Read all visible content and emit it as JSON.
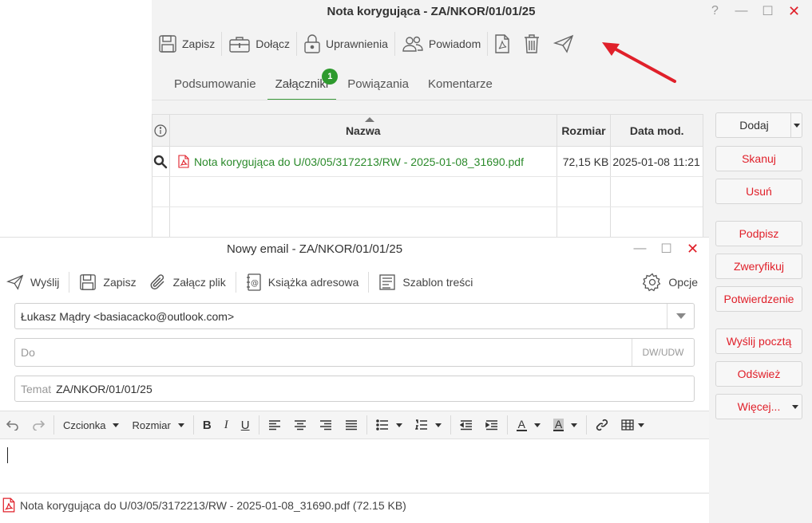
{
  "main_window": {
    "title": "Nota korygująca - ZA/NKOR/01/01/25",
    "controls": {
      "help": "?",
      "minimize": "—",
      "maximize": "☐",
      "close": "✕"
    },
    "toolbar": {
      "save": "Zapisz",
      "attach": "Dołącz",
      "permissions": "Uprawnienia",
      "notify": "Powiadom"
    },
    "tabs": [
      {
        "label": "Podsumowanie"
      },
      {
        "label": "Załączniki",
        "badge": "1"
      },
      {
        "label": "Powiązania"
      },
      {
        "label": "Komentarze"
      }
    ],
    "grid": {
      "columns": {
        "name": "Nazwa",
        "size": "Rozmiar",
        "date": "Data mod."
      },
      "rows": [
        {
          "name": "Nota korygująca do U/03/05/3172213/RW - 2025-01-08_31690.pdf",
          "size": "72,15 KB",
          "date": "2025-01-08 11:21"
        }
      ]
    },
    "actions": {
      "add": "Dodaj",
      "scan": "Skanuj",
      "delete": "Usuń",
      "sign": "Podpisz",
      "verify": "Zweryfikuj",
      "confirmation": "Potwierdzenie",
      "send_mail": "Wyślij pocztą",
      "refresh": "Odśwież",
      "more": "Więcej..."
    }
  },
  "email_window": {
    "title": "Nowy email - ZA/NKOR/01/01/25",
    "controls": {
      "minimize": "—",
      "maximize": "☐",
      "close": "✕"
    },
    "toolbar": {
      "send": "Wyślij",
      "save": "Zapisz",
      "attach": "Załącz plik",
      "address_book": "Książka adresowa",
      "template": "Szablon treści",
      "options": "Opcje"
    },
    "from": "Łukasz Mądry <basiacacko@outlook.com>",
    "to": {
      "placeholder": "Do",
      "value": "",
      "dw_label": "DW/UDW"
    },
    "subject": {
      "label": "Temat",
      "value": "ZA/NKOR/01/01/25"
    },
    "editor": {
      "font": "Czcionka",
      "size": "Rozmiar",
      "bold": "B",
      "italic": "I",
      "underline": "U",
      "text_color": "A",
      "bg_color": "A"
    },
    "attachment": "Nota korygująca do U/03/05/3172213/RW - 2025-01-08_31690.pdf (72.15 KB)"
  },
  "colors": {
    "accent_green": "#2e9a2e",
    "action_red": "#e0202a",
    "arrow_red": "#e0202a"
  }
}
